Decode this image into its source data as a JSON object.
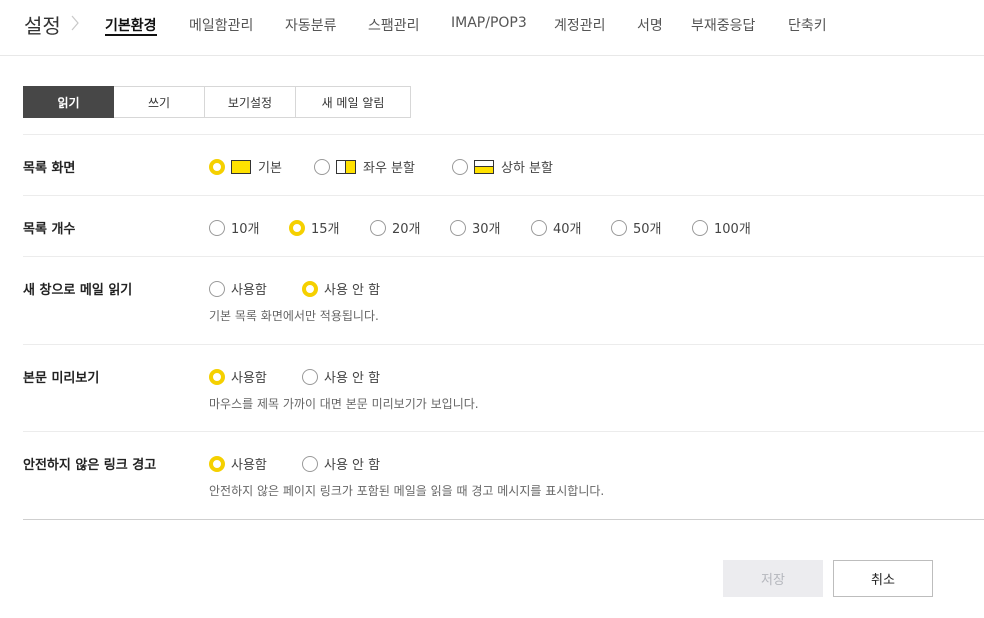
{
  "header": {
    "title": "설정",
    "tabs": [
      {
        "label": "기본환경",
        "active": true
      },
      {
        "label": "메일함관리"
      },
      {
        "label": "자동분류"
      },
      {
        "label": "스팸관리"
      },
      {
        "label": "IMAP/POP3"
      },
      {
        "label": "계정관리"
      },
      {
        "label": "서명"
      },
      {
        "label": "부재중응답"
      },
      {
        "label": "단축키"
      }
    ]
  },
  "subtabs": [
    {
      "label": "읽기",
      "active": true
    },
    {
      "label": "쓰기"
    },
    {
      "label": "보기설정"
    },
    {
      "label": "새 메일 알림"
    }
  ],
  "settings": {
    "list_view": {
      "label": "목록 화면",
      "options": [
        {
          "label": "기본",
          "icon": "layout-full-icon",
          "selected": true
        },
        {
          "label": "좌우 분할",
          "icon": "layout-left-right-icon",
          "selected": false
        },
        {
          "label": "상하 분할",
          "icon": "layout-top-bottom-icon",
          "selected": false
        }
      ]
    },
    "list_count": {
      "label": "목록 개수",
      "options": [
        {
          "label": "10개",
          "selected": false
        },
        {
          "label": "15개",
          "selected": true
        },
        {
          "label": "20개",
          "selected": false
        },
        {
          "label": "30개",
          "selected": false
        },
        {
          "label": "40개",
          "selected": false
        },
        {
          "label": "50개",
          "selected": false
        },
        {
          "label": "100개",
          "selected": false
        }
      ]
    },
    "new_window": {
      "label": "새 창으로 메일 읽기",
      "options": [
        {
          "label": "사용함",
          "selected": false
        },
        {
          "label": "사용 안 함",
          "selected": true
        }
      ],
      "description": "기본 목록 화면에서만 적용됩니다."
    },
    "preview": {
      "label": "본문 미리보기",
      "options": [
        {
          "label": "사용함",
          "selected": true
        },
        {
          "label": "사용 안 함",
          "selected": false
        }
      ],
      "description": "마우스를 제목 가까이 대면 본문 미리보기가 보입니다."
    },
    "unsafe_link": {
      "label": "안전하지 않은 링크 경고",
      "options": [
        {
          "label": "사용함",
          "selected": true
        },
        {
          "label": "사용 안 함",
          "selected": false
        }
      ],
      "description": "안전하지 않은 페이지 링크가 포함된 메일을 읽을 때 경고 메시지를 표시합니다."
    }
  },
  "actions": {
    "save_label": "저장",
    "cancel_label": "취소"
  },
  "colors": {
    "accent": "#f5d000",
    "active_subtab": "#474747",
    "disabled_button": "#ececef"
  }
}
